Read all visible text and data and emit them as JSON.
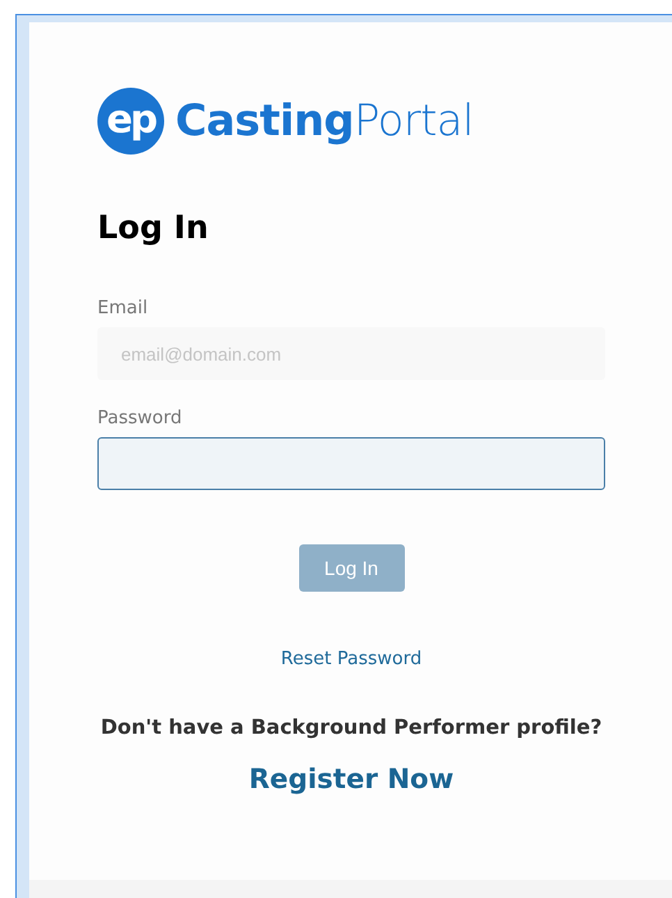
{
  "logo": {
    "mark": "ep",
    "name": "**Casting**Portal"
  },
  "heading": "Log In",
  "fields": [
    {
      "label": "Email",
      "placeholder": "email@domain.com",
      "focused": false
    },
    {
      "label": "Password",
      "focused": true
    }
  ],
  "submit": {
    "label": "Log In",
    "disabled": true
  },
  "reset_link": "Reset Password",
  "register_prompt": "Don't have a Background Performer profile?",
  "register_link": "Register Now"
}
